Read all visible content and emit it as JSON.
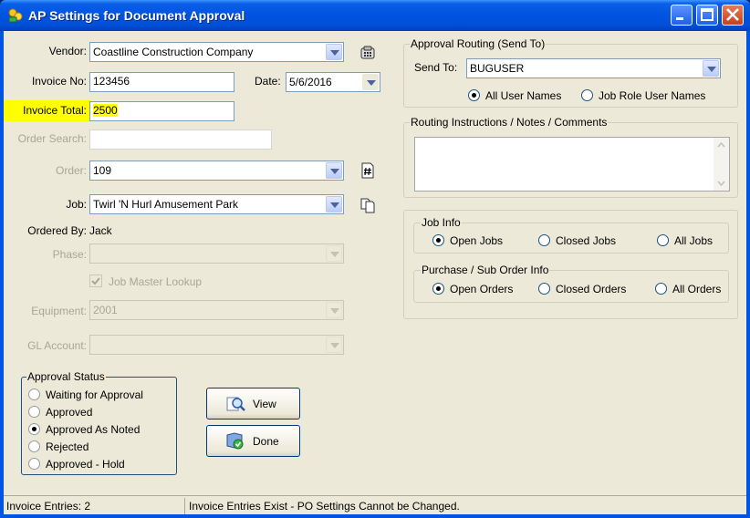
{
  "window": {
    "title": "AP Settings for Document Approval"
  },
  "form": {
    "vendor_label": "Vendor:",
    "vendor_value": "Coastline Construction Company",
    "invoice_no_label": "Invoice No:",
    "invoice_no_value": "123456",
    "date_label": "Date:",
    "date_value": "5/6/2016",
    "invoice_total_label": "Invoice Total:",
    "invoice_total_value": "2500",
    "order_search_label": "Order Search:",
    "order_search_value": "",
    "order_label": "Order:",
    "order_value": "109",
    "job_label": "Job:",
    "job_value": "Twirl 'N Hurl Amusement Park",
    "ordered_by_label": "Ordered By:",
    "ordered_by_value": "Jack",
    "phase_label": "Phase:",
    "phase_value": "",
    "job_master_lookup_label": "Job Master Lookup",
    "equipment_label": "Equipment:",
    "equipment_value": "2001",
    "gl_account_label": "GL Account:",
    "gl_account_value": ""
  },
  "approval_status": {
    "title": "Approval Status",
    "options": [
      "Waiting for Approval",
      "Approved",
      "Approved As Noted",
      "Rejected",
      "Approved - Hold"
    ],
    "selected": "Approved As Noted"
  },
  "buttons": {
    "view": "View",
    "done": "Done"
  },
  "routing": {
    "title": "Approval Routing (Send To)",
    "send_to_label": "Send To:",
    "send_to_value": "BUGUSER",
    "all_user_names": "All User Names",
    "job_role_user_names": "Job Role User Names"
  },
  "notes": {
    "title": "Routing Instructions / Notes / Comments",
    "value": ""
  },
  "job_info": {
    "title": "Job Info",
    "open": "Open Jobs",
    "closed": "Closed Jobs",
    "all": "All Jobs"
  },
  "po_info": {
    "title": "Purchase / Sub Order Info",
    "open": "Open Orders",
    "closed": "Closed Orders",
    "all": "All Orders"
  },
  "status_bar": {
    "left": "Invoice Entries: 2",
    "right": "Invoice Entries Exist - PO Settings Cannot be Changed."
  },
  "colors": {
    "highlight": "#ffff00",
    "titlebar": "#0054e3"
  }
}
